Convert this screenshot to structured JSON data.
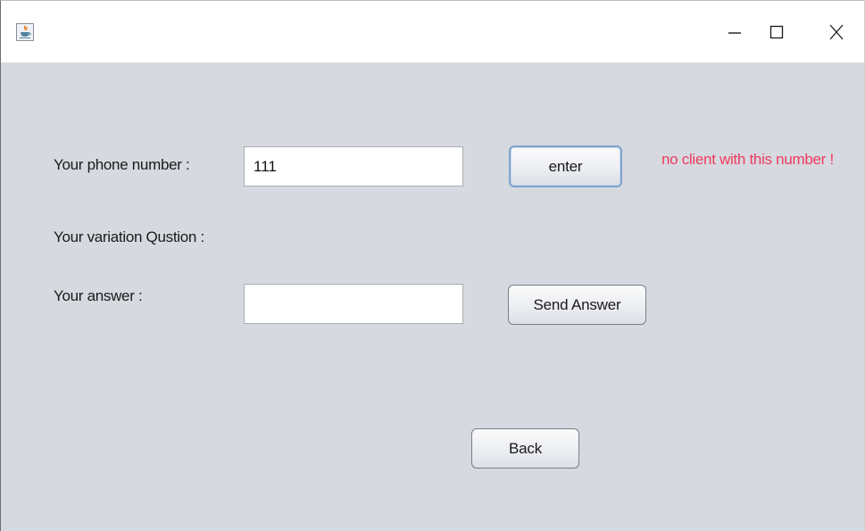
{
  "window": {
    "icon": "java-coffee-icon",
    "controls": {
      "minimize": "–",
      "maximize": "☐",
      "close": "X"
    }
  },
  "form": {
    "phone_label": "Your phone number :",
    "phone_value": "111",
    "enter_button": "enter",
    "error_message": "no client with this number !",
    "question_label": "Your variation Qustion :",
    "answer_label": "Your answer :",
    "answer_value": "",
    "send_button": "Send Answer",
    "back_button": "Back"
  },
  "colors": {
    "background": "#d6d9df",
    "error": "#ef3b5f",
    "focus_border": "#7fa3cf"
  }
}
